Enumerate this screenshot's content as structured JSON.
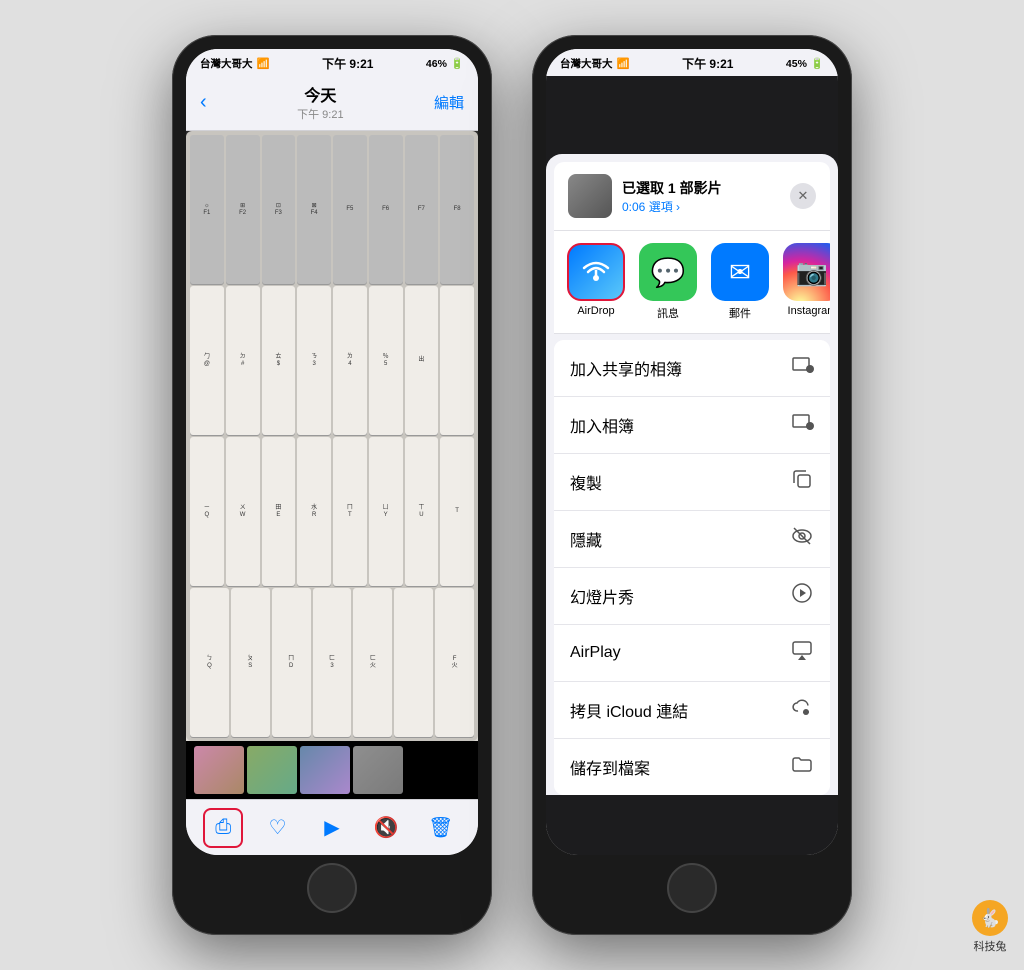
{
  "phone1": {
    "status": {
      "carrier": "台灣大哥大",
      "wifi": "WiFi",
      "time": "下午 9:21",
      "battery": "46%"
    },
    "nav": {
      "back_label": "‹",
      "title": "今天",
      "subtitle": "下午 9:21",
      "edit": "編輯"
    },
    "toolbar": {
      "share_label": "share",
      "like_label": "like",
      "play_label": "play",
      "mute_label": "mute",
      "delete_label": "delete"
    }
  },
  "phone2": {
    "status": {
      "carrier": "台灣大哥大",
      "wifi": "WiFi",
      "time": "下午 9:21",
      "battery": "45%"
    },
    "share_sheet": {
      "title": "已選取 1 部影片",
      "subtitle": "0:06 選項 ›",
      "close": "✕",
      "apps": [
        {
          "name": "AirDrop",
          "type": "airdrop"
        },
        {
          "name": "訊息",
          "type": "messages"
        },
        {
          "name": "郵件",
          "type": "mail"
        },
        {
          "name": "Instagram",
          "type": "instagram"
        }
      ],
      "menu_items": [
        {
          "label": "加入共享的相簿",
          "icon": "📤"
        },
        {
          "label": "加入相簿",
          "icon": "📥"
        },
        {
          "label": "複製",
          "icon": "📋"
        },
        {
          "label": "隱藏",
          "icon": "👁"
        },
        {
          "label": "幻燈片秀",
          "icon": "▶"
        },
        {
          "label": "AirPlay",
          "icon": "📺"
        },
        {
          "label": "拷貝 iCloud 連結",
          "icon": "☁"
        },
        {
          "label": "儲存到檔案",
          "icon": "📁"
        }
      ]
    }
  },
  "watermark": {
    "icon": "🐇",
    "text": "科技兔"
  }
}
